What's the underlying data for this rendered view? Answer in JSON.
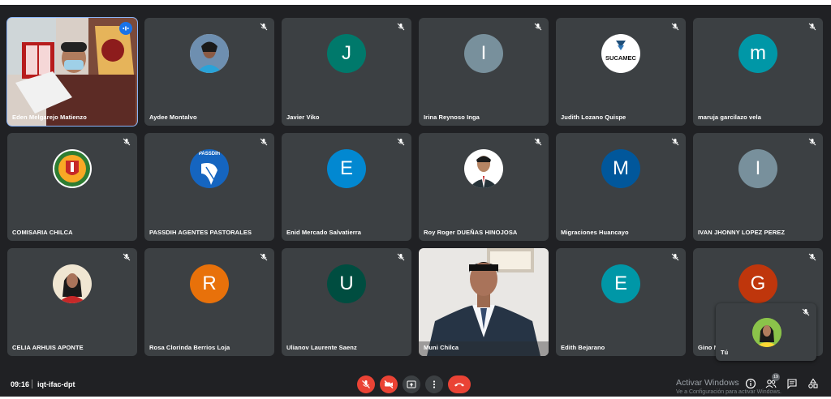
{
  "meeting": {
    "time": "09:16",
    "code": "iqt-ifac-dpt",
    "participant_count": "19"
  },
  "tiles": [
    {
      "name": "Eden Melgarejo Matienzo",
      "type": "video",
      "speaking": true
    },
    {
      "name": "Aydee Montalvo",
      "type": "photo"
    },
    {
      "name": "Javier Viko",
      "type": "letter",
      "letter": "J",
      "color": "#00796b"
    },
    {
      "name": "Irina Reynoso Inga",
      "type": "letter",
      "letter": "I",
      "color": "#78909c"
    },
    {
      "name": "Judith Lozano Quispe",
      "type": "logo",
      "logo_text": "SUCAMEC"
    },
    {
      "name": "maruja garcilazo vela",
      "type": "letter",
      "letter": "m",
      "color": "#0097a7"
    },
    {
      "name": "COMISARIA CHILCA",
      "type": "emblem"
    },
    {
      "name": "PASSDIH AGENTES PASTORALES",
      "type": "logo2",
      "logo_text": "PASSDIH"
    },
    {
      "name": "Enid Mercado Salvatierra",
      "type": "letter",
      "letter": "E",
      "color": "#0288d1"
    },
    {
      "name": "Roy Roger DUEÑAS HINOJOSA",
      "type": "photo"
    },
    {
      "name": "Migraciones Huancayo",
      "type": "letter",
      "letter": "M",
      "color": "#01579b"
    },
    {
      "name": "IVAN JHONNY LOPEZ PEREZ",
      "type": "letter",
      "letter": "I",
      "color": "#78909c"
    },
    {
      "name": "CELIA ARHUIS APONTE",
      "type": "photo"
    },
    {
      "name": "Rosa Clorinda Berrios Loja",
      "type": "letter",
      "letter": "R",
      "color": "#e8710a"
    },
    {
      "name": "Ulianov Laurente Saenz",
      "type": "letter",
      "letter": "U",
      "color": "#004d40"
    },
    {
      "name": "Muni Chilca",
      "type": "video"
    },
    {
      "name": "Edith Bejarano",
      "type": "letter",
      "letter": "E",
      "color": "#0097a7"
    },
    {
      "name": "Gino N",
      "type": "letter",
      "letter": "G",
      "color": "#bf360c"
    }
  ],
  "self_view": {
    "label": "Tú"
  },
  "watermark": {
    "line1": "Activar Windows",
    "line2": "Ve a Configuración para activar Windows."
  },
  "colors": {
    "background": "#202124",
    "tile": "#3c4043",
    "danger": "#ea4335",
    "active_border": "#8ab4f8"
  }
}
